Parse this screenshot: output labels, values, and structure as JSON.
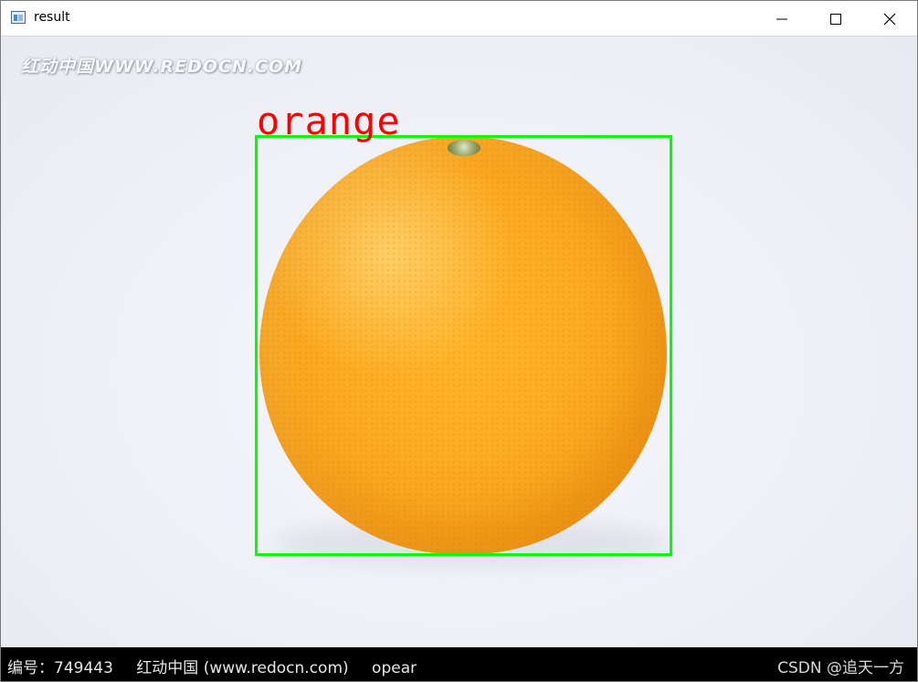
{
  "window": {
    "title": "result"
  },
  "image": {
    "watermark": "红动中国WWW.REDOCN.COM",
    "detection": {
      "label": "orange",
      "box_color": "#00ff00",
      "label_color": "#ff0000"
    }
  },
  "footer": {
    "id_text": "编号：749443",
    "site_text": "红动中国 (www.redocn.com)",
    "author_text": "opear",
    "credit_text": "CSDN @追天一方"
  },
  "icons": [
    "app-icon",
    "minimize-icon",
    "maximize-icon",
    "close-icon"
  ]
}
